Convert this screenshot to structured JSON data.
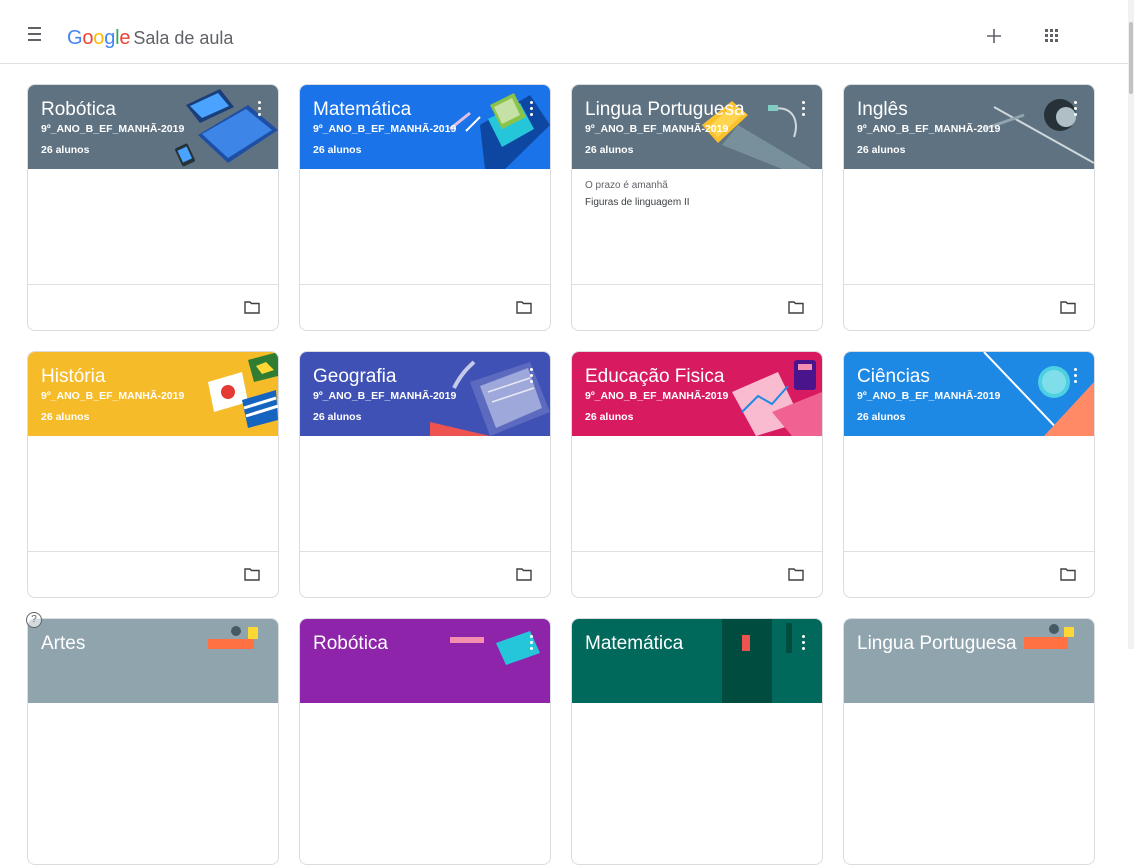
{
  "app": {
    "logo_text": "Google",
    "name": "Sala de aula"
  },
  "header": {
    "add_icon": "plus-icon",
    "apps_icon": "apps-grid-icon",
    "menu_icon": "hamburger-menu-icon"
  },
  "colors": {
    "slate": "#5f7282",
    "blue": "#1a73e8",
    "yellow": "#f6bb29",
    "indigo": "#3f51b5",
    "pink": "#d81b60",
    "sky": "#1e88e5",
    "purple": "#8e24aa",
    "teal": "#00695c",
    "grey": "#90a4ae"
  },
  "classes": [
    {
      "title": "Robótica",
      "section": "9º_ANO_B_EF_MANHÃ-2019",
      "students": "26 alunos"
    },
    {
      "title": "Matemática",
      "section": "9º_ANO_B_EF_MANHÃ-2019",
      "students": "26 alunos"
    },
    {
      "title": "Lingua Portuguesa",
      "section": "9º_ANO_B_EF_MANHÃ-2019",
      "students": "26 alunos",
      "due_label": "O prazo é amanhã",
      "due_item": "Figuras de linguagem II"
    },
    {
      "title": "Inglês",
      "section": "9º_ANO_B_EF_MANHÃ-2019",
      "students": "26 alunos"
    },
    {
      "title": "História",
      "section": "9º_ANO_B_EF_MANHÃ-2019",
      "students": "26 alunos"
    },
    {
      "title": "Geografia",
      "section": "9º_ANO_B_EF_MANHÃ-2019",
      "students": "26 alunos"
    },
    {
      "title": "Educação Fisica",
      "section": "9º_ANO_B_EF_MANHÃ-2019",
      "students": "26 alunos"
    },
    {
      "title": "Ciências",
      "section": "9º_ANO_B_EF_MANHÃ-2019",
      "students": "26 alunos"
    },
    {
      "title": "Artes"
    },
    {
      "title": "Robótica"
    },
    {
      "title": "Matemática"
    },
    {
      "title": "Lingua Portuguesa"
    }
  ],
  "help": {
    "label": "?"
  }
}
